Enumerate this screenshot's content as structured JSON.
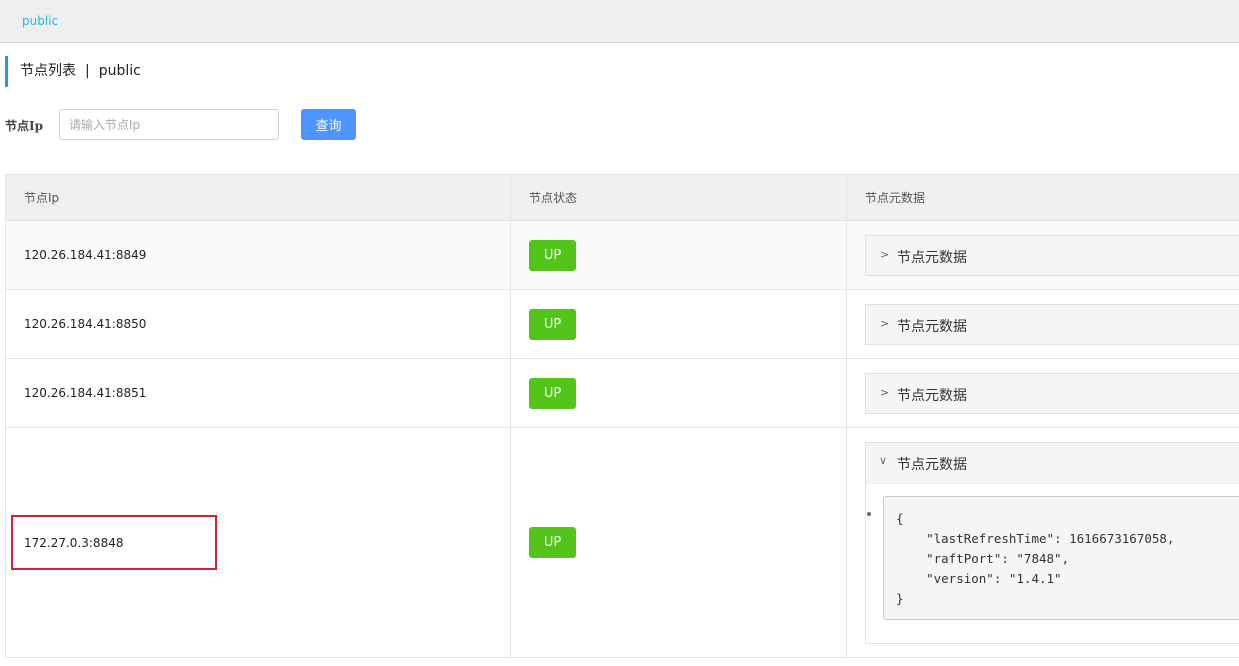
{
  "top_bar": {
    "tag": "public"
  },
  "page_title": {
    "label": "节点列表",
    "separator": "|",
    "namespace": "public"
  },
  "search": {
    "label": "节点Ip",
    "placeholder": "请输入节点Ip",
    "value": "",
    "button_label": "查询"
  },
  "table": {
    "headers": [
      "节点Ip",
      "节点状态",
      "节点元数据"
    ],
    "rows": [
      {
        "ip": "120.26.184.41:8849",
        "status": "UP",
        "meta_title": "节点元数据",
        "expanded": false
      },
      {
        "ip": "120.26.184.41:8850",
        "status": "UP",
        "meta_title": "节点元数据",
        "expanded": false
      },
      {
        "ip": "120.26.184.41:8851",
        "status": "UP",
        "meta_title": "节点元数据",
        "expanded": false
      },
      {
        "ip": "172.27.0.3:8848",
        "status": "UP",
        "meta_title": "节点元数据",
        "expanded": true,
        "metadata_json": "{\n    \"lastRefreshTime\": 1616673167058,\n    \"raftPort\": \"7848\",\n    \"version\": \"1.4.1\"\n}"
      }
    ]
  },
  "icons": {
    "collapsed": "chevron-right-icon",
    "expanded": "chevron-down-icon"
  },
  "colors": {
    "accent": "#20a0d7",
    "button": "#4e95ff",
    "status_up": "#52c41a",
    "highlight": "#d9212b"
  }
}
